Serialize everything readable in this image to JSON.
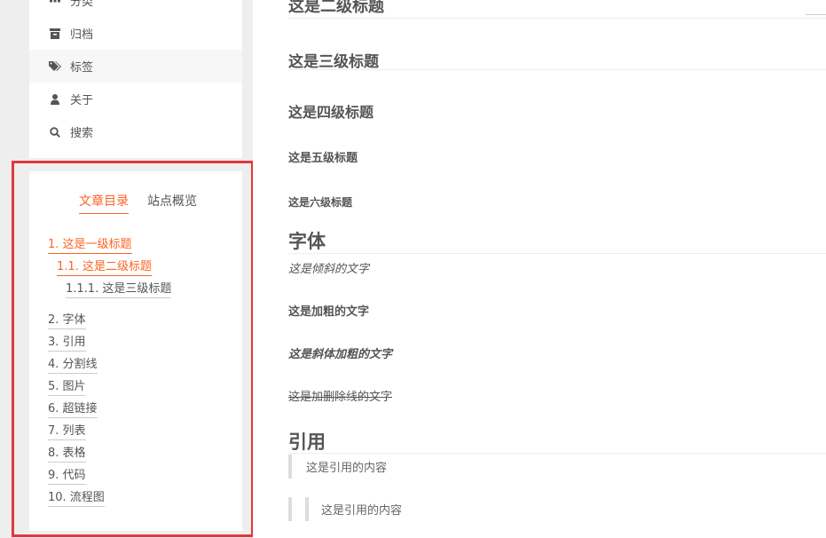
{
  "menu": {
    "items": [
      {
        "label": "分类",
        "icon": "grid-icon"
      },
      {
        "label": "归档",
        "icon": "archive-icon"
      },
      {
        "label": "标签",
        "icon": "tags-icon"
      },
      {
        "label": "关于",
        "icon": "user-icon"
      },
      {
        "label": "搜索",
        "icon": "search-icon"
      }
    ]
  },
  "toc": {
    "tabs": [
      {
        "label": "文章目录",
        "active": true
      },
      {
        "label": "站点概览",
        "active": false
      }
    ],
    "items": [
      {
        "label": "1. 这是一级标题",
        "active": true
      },
      {
        "label": "1.1. 这是二级标题",
        "active": true
      },
      {
        "label": "1.1.1. 这是三级标题",
        "active": false
      },
      {
        "label": "2. 字体",
        "active": false
      },
      {
        "label": "3. 引用",
        "active": false
      },
      {
        "label": "4. 分割线",
        "active": false
      },
      {
        "label": "5. 图片",
        "active": false
      },
      {
        "label": "6. 超链接",
        "active": false
      },
      {
        "label": "7. 列表",
        "active": false
      },
      {
        "label": "8. 表格",
        "active": false
      },
      {
        "label": "9. 代码",
        "active": false
      },
      {
        "label": "10. 流程图",
        "active": false
      }
    ]
  },
  "content": {
    "h2_top": "这是二级标题",
    "h3": "这是三级标题",
    "h4": "这是四级标题",
    "h5": "这是五级标题",
    "h6": "这是六级标题",
    "fonts_heading": "字体",
    "italic_text": "这是倾斜的文字",
    "bold_text": "这是加粗的文字",
    "bold_italic_text": "这是斜体加粗的文字",
    "strike_text": "这是加删除线的文字",
    "quote_heading": "引用",
    "quote_1": "这是引用的内容",
    "quote_2": "这是引用的内容"
  },
  "colors": {
    "accent": "#fc6423",
    "highlight_frame": "#e0393e",
    "text": "#555555",
    "background": "#eeeeee"
  }
}
